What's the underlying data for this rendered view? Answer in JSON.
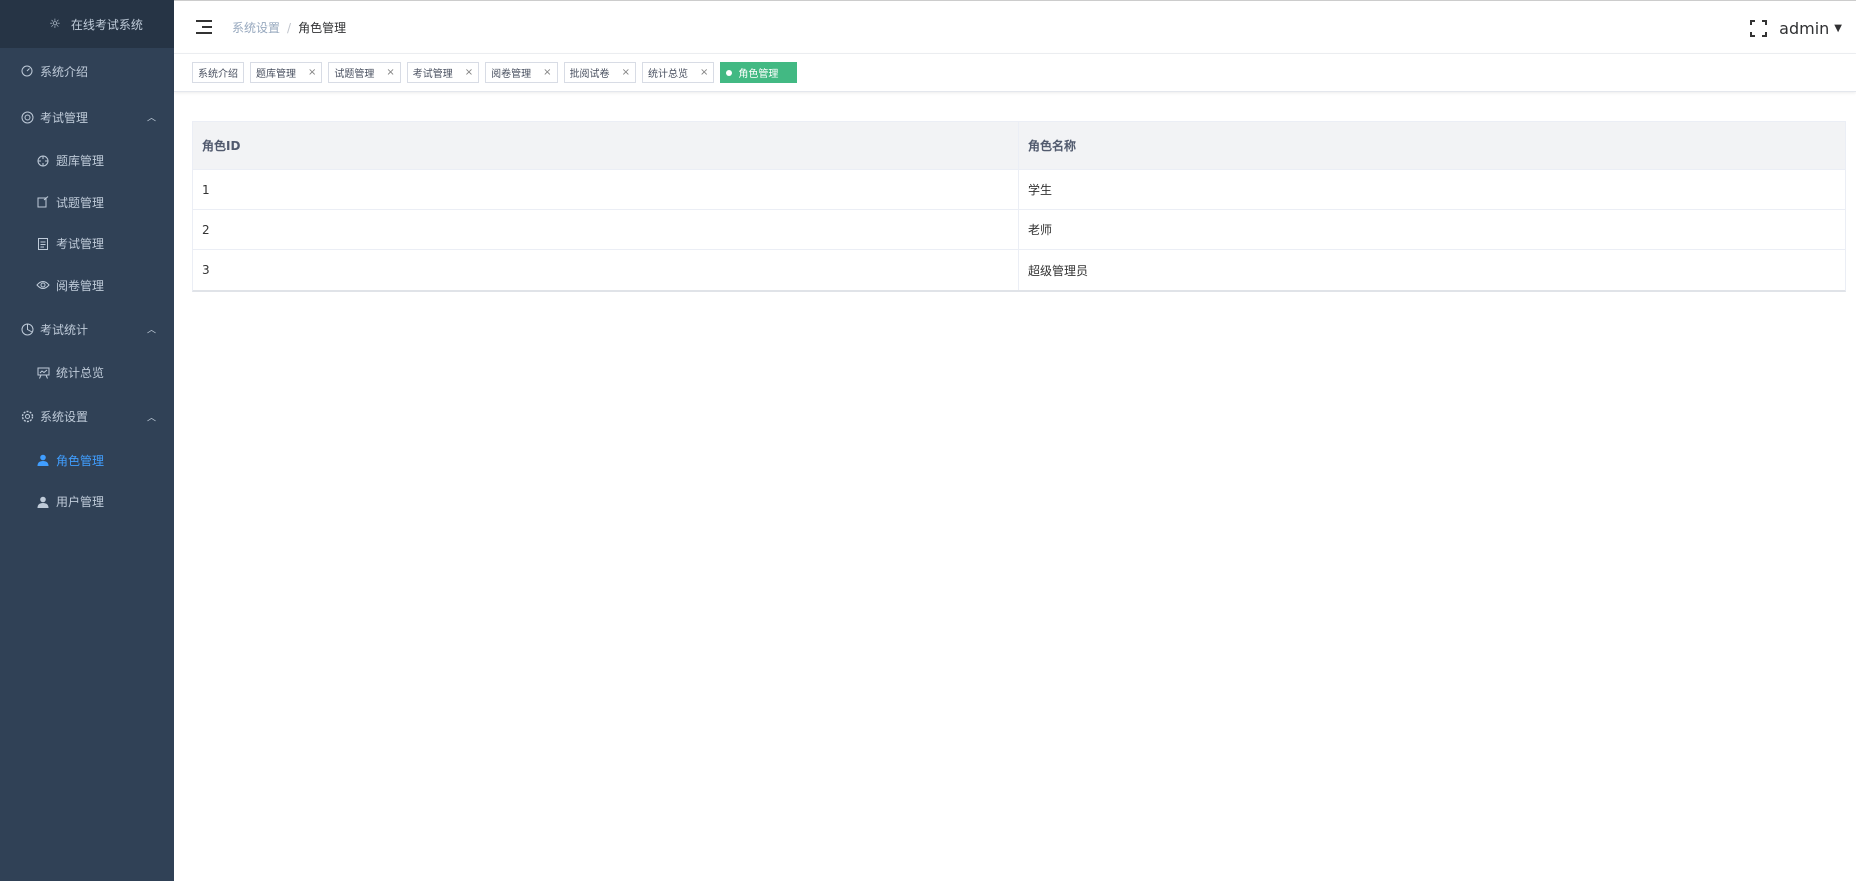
{
  "app": {
    "title": "在线考试系统"
  },
  "sidebar": {
    "items": [
      {
        "label": "系统介绍",
        "icon": "dashboard-icon",
        "level": 1
      },
      {
        "label": "考试管理",
        "icon": "exam-icon",
        "level": 1,
        "expanded": true
      },
      {
        "label": "题库管理",
        "icon": "target-icon",
        "level": 2
      },
      {
        "label": "试题管理",
        "icon": "edit-doc-icon",
        "level": 2
      },
      {
        "label": "考试管理",
        "icon": "document-icon",
        "level": 2
      },
      {
        "label": "阅卷管理",
        "icon": "eye-icon",
        "level": 2
      },
      {
        "label": "考试统计",
        "icon": "pie-chart-icon",
        "level": 1,
        "expanded": true
      },
      {
        "label": "统计总览",
        "icon": "presentation-icon",
        "level": 2
      },
      {
        "label": "系统设置",
        "icon": "gear-icon",
        "level": 1,
        "expanded": true
      },
      {
        "label": "角色管理",
        "icon": "user-icon",
        "level": 2,
        "active": true
      },
      {
        "label": "用户管理",
        "icon": "user-icon",
        "level": 2
      }
    ]
  },
  "header": {
    "breadcrumb": [
      "系统设置",
      "角色管理"
    ],
    "user": "admin"
  },
  "tags": [
    {
      "label": "系统介绍",
      "closable": false
    },
    {
      "label": "题库管理",
      "closable": true
    },
    {
      "label": "试题管理",
      "closable": true
    },
    {
      "label": "考试管理",
      "closable": true
    },
    {
      "label": "阅卷管理",
      "closable": true
    },
    {
      "label": "批阅试卷",
      "closable": true
    },
    {
      "label": "统计总览",
      "closable": true
    },
    {
      "label": "角色管理",
      "closable": false,
      "active": true
    }
  ],
  "table": {
    "columns": [
      "角色ID",
      "角色名称"
    ],
    "rows": [
      [
        "1",
        "学生"
      ],
      [
        "2",
        "老师"
      ],
      [
        "3",
        "超级管理员"
      ]
    ]
  },
  "colors": {
    "sidebar_bg": "#304156",
    "sidebar_text": "#bfcbd9",
    "active_menu": "#409eff",
    "active_tag": "#42b983"
  }
}
